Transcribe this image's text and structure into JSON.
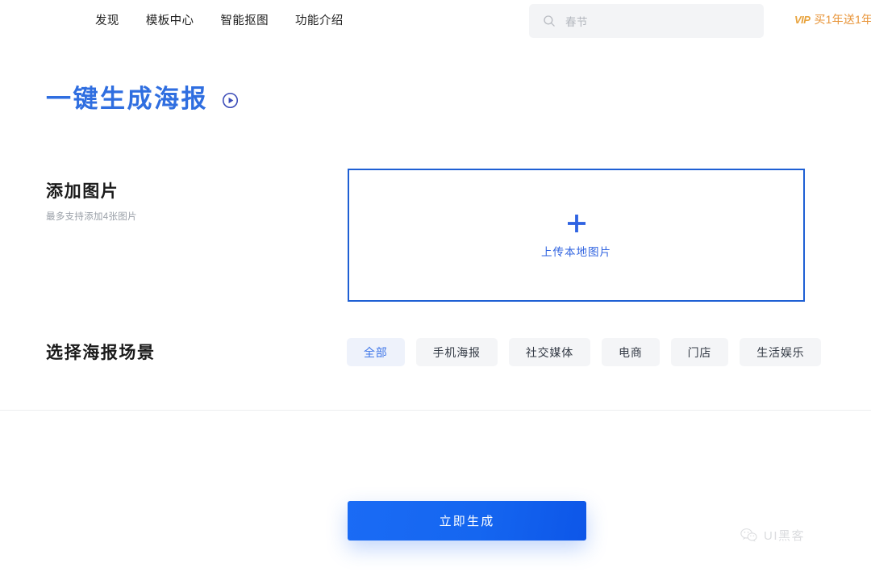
{
  "header": {
    "nav_items": [
      {
        "label": "发现",
        "name": "nav-discover"
      },
      {
        "label": "模板中心",
        "name": "nav-template-center"
      },
      {
        "label": "智能抠图",
        "name": "nav-smart-cutout"
      },
      {
        "label": "功能介绍",
        "name": "nav-features"
      }
    ],
    "search": {
      "placeholder": "春节",
      "icon": "search-icon"
    },
    "vip": {
      "badge": "VIP",
      "label": "买1年送1年"
    }
  },
  "main": {
    "title": "一键生成海报",
    "title_icon": "play-circle-icon",
    "add_image": {
      "heading": "添加图片",
      "subtext": "最多支持添加4张图片",
      "upload": {
        "icon": "plus-icon",
        "label": "上传本地图片"
      }
    },
    "scene": {
      "heading": "选择海报场景",
      "chips": [
        {
          "label": "全部",
          "selected": true
        },
        {
          "label": "手机海报",
          "selected": false
        },
        {
          "label": "社交媒体",
          "selected": false
        },
        {
          "label": "电商",
          "selected": false
        },
        {
          "label": "门店",
          "selected": false
        },
        {
          "label": "生活娱乐",
          "selected": false
        }
      ]
    }
  },
  "footer": {
    "generate_button": "立即生成",
    "watermark": {
      "icon": "wechat-icon",
      "text": "UI黑客"
    }
  },
  "colors": {
    "primary_blue": "#2f6ee0",
    "button_blue": "#1566f0",
    "upload_border": "#1e5fd4",
    "chip_active_bg": "#eef2fb",
    "chip_bg": "#f4f5f7",
    "vip_orange": "#e8953a",
    "search_bg": "#f3f4f6"
  }
}
